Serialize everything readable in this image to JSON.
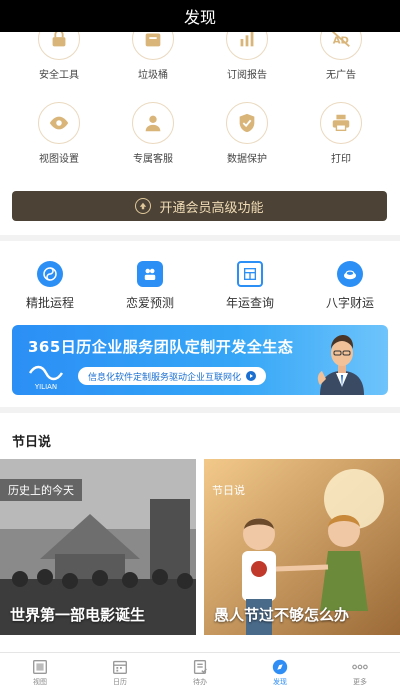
{
  "title": "发现",
  "vip_grid": {
    "row1": [
      {
        "label": "安全工具",
        "icon": "lock-icon"
      },
      {
        "label": "垃圾桶",
        "icon": "trash-icon"
      },
      {
        "label": "订阅报告",
        "icon": "chart-icon"
      },
      {
        "label": "无广告",
        "icon": "no-ads-icon"
      }
    ],
    "row2": [
      {
        "label": "视图设置",
        "icon": "eye-icon"
      },
      {
        "label": "专属客服",
        "icon": "support-icon"
      },
      {
        "label": "数据保护",
        "icon": "shield-icon"
      },
      {
        "label": "打印",
        "icon": "printer-icon"
      }
    ]
  },
  "vip_button": {
    "label": "开通会员高级功能"
  },
  "tools": [
    {
      "label": "精批运程",
      "icon": "fortune-icon",
      "color": "#2b8ff5"
    },
    {
      "label": "恋爱预测",
      "icon": "love-icon",
      "color": "#2b8ff5"
    },
    {
      "label": "年运查询",
      "icon": "year-icon",
      "color": "#2b8ff5"
    },
    {
      "label": "八字财运",
      "icon": "wealth-icon",
      "color": "#2b8ff5"
    }
  ],
  "banner": {
    "title": "365日历企业服务团队定制开发全生态",
    "subtitle": "信息化软件定制服务驱动企业互联网化",
    "logo_text": "YILIAN"
  },
  "festival": {
    "title": "节日说",
    "cards": [
      {
        "tag": "历史上的今天",
        "caption": "世界第一部电影诞生"
      },
      {
        "tag": "节日说",
        "caption": "愚人节过不够怎么办"
      }
    ]
  },
  "tabbar": {
    "items": [
      {
        "label": "视图",
        "icon": "view-icon",
        "active": false
      },
      {
        "label": "日历",
        "icon": "calendar-icon",
        "active": false
      },
      {
        "label": "待办",
        "icon": "todo-icon",
        "active": false
      },
      {
        "label": "发现",
        "icon": "discover-icon",
        "active": true
      },
      {
        "label": "更多",
        "icon": "more-icon",
        "active": false
      }
    ]
  },
  "colors": {
    "accent": "#2e8ef5",
    "gold": "#d9b57a",
    "vip_bg": "#4c4336"
  }
}
